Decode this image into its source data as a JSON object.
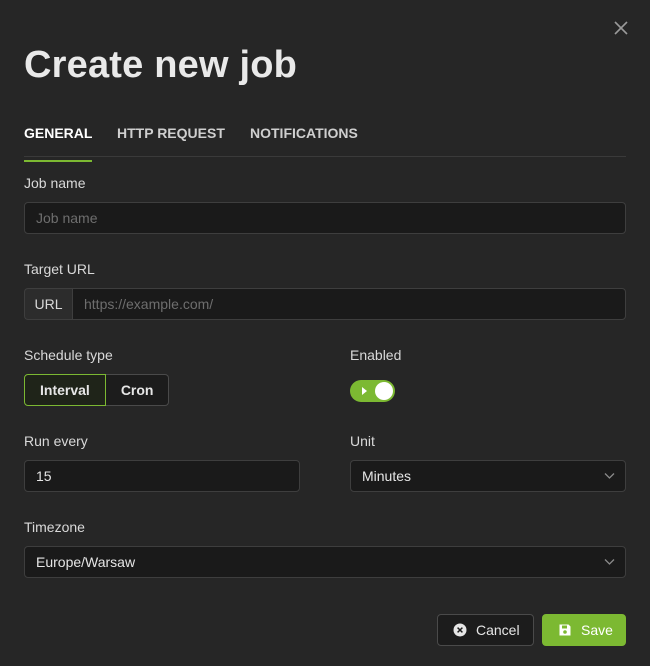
{
  "dialog": {
    "title": "Create new job",
    "close_icon": "close-icon"
  },
  "tabs": [
    {
      "label": "GENERAL",
      "active": true
    },
    {
      "label": "HTTP REQUEST",
      "active": false
    },
    {
      "label": "NOTIFICATIONS",
      "active": false
    }
  ],
  "form": {
    "job_name": {
      "label": "Job name",
      "placeholder": "Job name",
      "value": ""
    },
    "target_url": {
      "label": "Target URL",
      "addon": "URL",
      "placeholder": "https://example.com/",
      "value": ""
    },
    "schedule_type": {
      "label": "Schedule type",
      "options": [
        "Interval",
        "Cron"
      ],
      "selected": "Interval"
    },
    "enabled": {
      "label": "Enabled",
      "on": true
    },
    "run_every": {
      "label": "Run every",
      "value": "15"
    },
    "unit": {
      "label": "Unit",
      "value": "Minutes"
    },
    "timezone": {
      "label": "Timezone",
      "value": "Europe/Warsaw"
    }
  },
  "footer": {
    "cancel_label": "Cancel",
    "save_label": "Save",
    "cancel_icon": "x-circle-icon",
    "save_icon": "floppy-disk-icon"
  },
  "colors": {
    "background": "#262626",
    "input_background": "#1a1a1a",
    "accent": "#7cb932",
    "border": "#3e3e3e"
  }
}
